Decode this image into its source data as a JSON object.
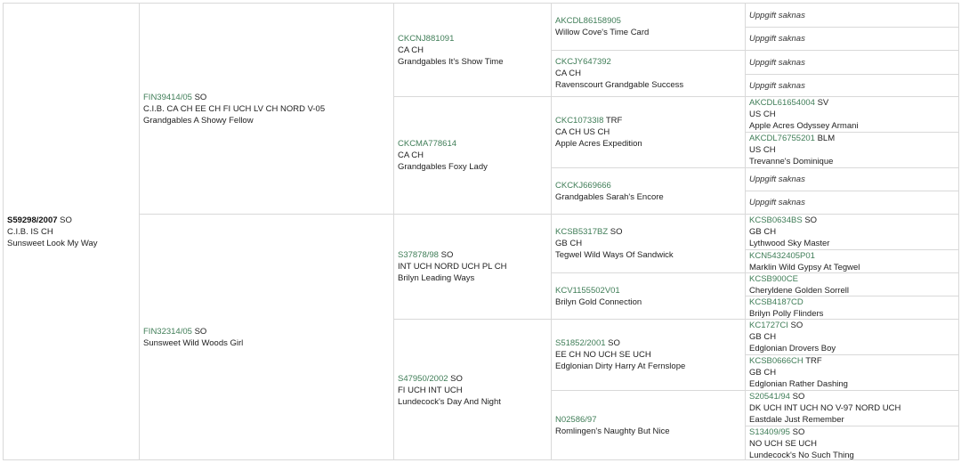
{
  "pedigree": {
    "subject": {
      "reg": "S59298/2007",
      "suffix": "SO",
      "titles": "C.I.B. IS CH",
      "name": "Sunsweet Look My Way"
    },
    "sire": {
      "reg": "FIN39414/05",
      "suffix": "SO",
      "titles": "C.I.B. CA CH EE CH FI UCH LV CH NORD V-05",
      "name": "Grandgables A Showy Fellow"
    },
    "dam": {
      "reg": "FIN32314/05",
      "suffix": "SO",
      "name": "Sunsweet Wild Woods Girl"
    },
    "gen3": [
      {
        "reg": "CKCNJ881091",
        "titles": "CA CH",
        "name": "Grandgables It's Show Time"
      },
      {
        "reg": "CKCMA778614",
        "titles": "CA CH",
        "name": "Grandgables Foxy Lady"
      },
      {
        "reg": "S37878/98",
        "suffix": "SO",
        "titles": "INT UCH NORD UCH PL CH",
        "name": "Brilyn Leading Ways"
      },
      {
        "reg": "S47950/2002",
        "suffix": "SO",
        "titles": "FI UCH INT UCH",
        "name": "Lundecock's Day And Night"
      }
    ],
    "gen4": [
      {
        "reg": "AKCDL86158905",
        "name": "Willow Cove's Time Card"
      },
      {
        "reg": "CKCJY647392",
        "titles": "CA CH",
        "name": "Ravenscourt Grandgable Success"
      },
      {
        "reg": "CKC10733I8",
        "suffix": "TRF",
        "titles": "CA CH US CH",
        "name": "Apple Acres Expedition"
      },
      {
        "reg": "CKCKJ669666",
        "name": "Grandgables Sarah's Encore"
      },
      {
        "reg": "KCSB5317BZ",
        "suffix": "SO",
        "titles": "GB CH",
        "name": "Tegwel Wild Ways Of Sandwick"
      },
      {
        "reg": "KCV1155502V01",
        "name": "Brilyn Gold Connection"
      },
      {
        "reg": "S51852/2001",
        "suffix": "SO",
        "titles": "EE CH NO UCH SE UCH",
        "name": "Edglonian Dirty Harry At Fernslope"
      },
      {
        "reg": "N02586/97",
        "name": "Romlingen's Naughty But Nice"
      }
    ],
    "gen5": [
      {
        "missing": "Uppgift saknas"
      },
      {
        "missing": "Uppgift saknas"
      },
      {
        "missing": "Uppgift saknas"
      },
      {
        "missing": "Uppgift saknas"
      },
      {
        "reg": "AKCDL61654004",
        "suffix": "SV",
        "titles": "US CH",
        "name": "Apple Acres Odyssey Armani"
      },
      {
        "reg": "AKCDL76755201",
        "suffix": "BLM",
        "titles": "US CH",
        "name": "Trevanne's Dominique"
      },
      {
        "missing": "Uppgift saknas"
      },
      {
        "missing": "Uppgift saknas"
      },
      {
        "reg": "KCSB0634BS",
        "suffix": "SO",
        "titles": "GB CH",
        "name": "Lythwood Sky Master"
      },
      {
        "reg": "KCN5432405P01",
        "name": "Marklin Wild Gypsy At Tegwel"
      },
      {
        "reg": "KCSB900CE",
        "name": "Cheryldene Golden Sorrell"
      },
      {
        "reg": "KCSB4187CD",
        "name": "Brilyn Polly Flinders"
      },
      {
        "reg": "KC1727CI",
        "suffix": "SO",
        "titles": "GB CH",
        "name": "Edglonian Drovers Boy"
      },
      {
        "reg": "KCSB0666CH",
        "suffix": "TRF",
        "titles": "GB CH",
        "name": "Edglonian Rather Dashing"
      },
      {
        "reg": "S20541/94",
        "suffix": "SO",
        "titles": "DK UCH INT UCH NO V-97 NORD UCH",
        "name": "Eastdale Just Remember"
      },
      {
        "reg": "S13409/95",
        "suffix": "SO",
        "titles": "NO UCH SE UCH",
        "name": "Lundecock's No Such Thing"
      }
    ]
  }
}
